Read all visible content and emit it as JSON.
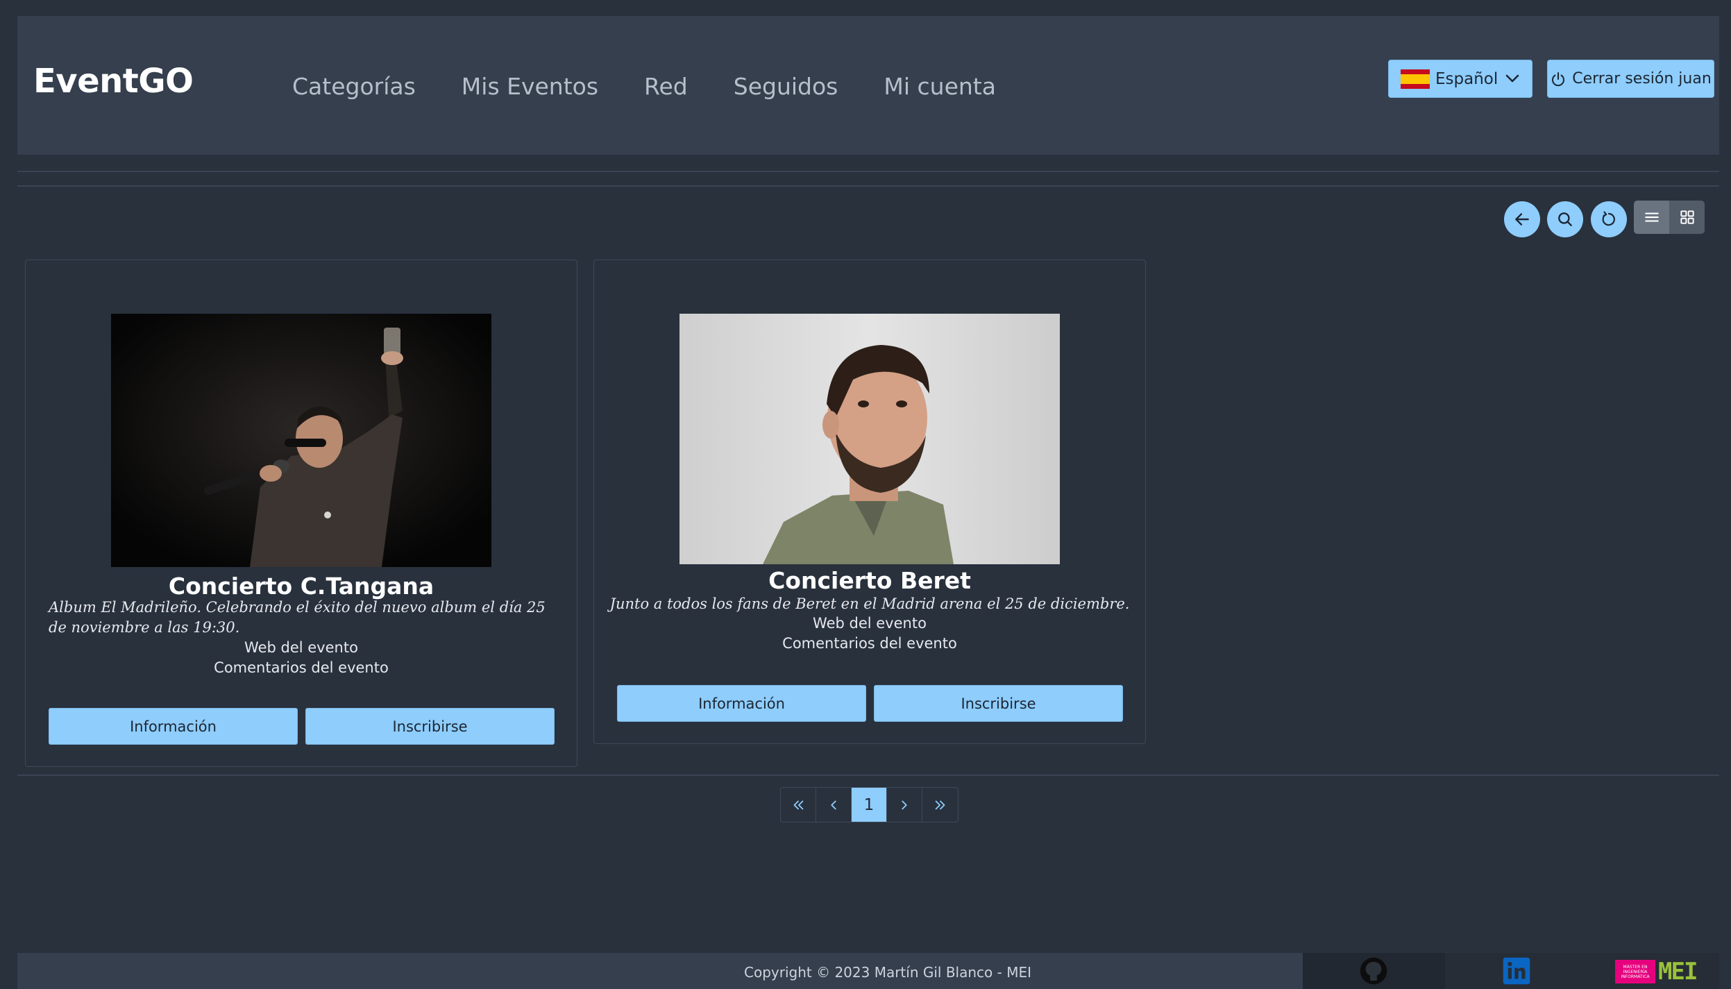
{
  "navbar": {
    "brand": "EventGO",
    "links": [
      "Categorías",
      "Mis Eventos",
      "Red",
      "Seguidos",
      "Mi cuenta"
    ],
    "language": {
      "selected": "Español",
      "flag_icon": "spain-flag-icon"
    },
    "logout_label": "Cerrar sesión juan"
  },
  "toolbar": {
    "icons": [
      "arrow-left-icon",
      "search-icon",
      "refresh-icon",
      "list-view-icon",
      "grid-view-icon"
    ]
  },
  "events": [
    {
      "title": "Concierto C.Tangana",
      "description": "Album El Madrileño. Celebrando el éxito del nuevo album el día 25 de noviembre a las 19:30.",
      "web_link": "Web del evento",
      "comments_link": "Comentarios del evento",
      "info_label": "Información",
      "subscribe_label": "Inscribirse"
    },
    {
      "title": "Concierto Beret",
      "description": "Junto a todos los fans de Beret en el Madrid arena el 25 de diciembre.",
      "web_link": "Web del evento",
      "comments_link": "Comentarios del evento",
      "info_label": "Información",
      "subscribe_label": "Inscribirse"
    }
  ],
  "pagination": {
    "current_page": "1",
    "first": "«",
    "prev": "‹",
    "next": "›",
    "last": "»"
  },
  "footer": {
    "copyright": "Copyright © 2023 Martín Gil Blanco - MEI",
    "mei_logo_caption": "MÁSTER EN INGENIERÍA INFORMÁTICA",
    "mei_logo_text": "MEI"
  },
  "colors": {
    "background": "#29313d",
    "navbar": "#353f4e",
    "accent": "#8ecdfc"
  }
}
